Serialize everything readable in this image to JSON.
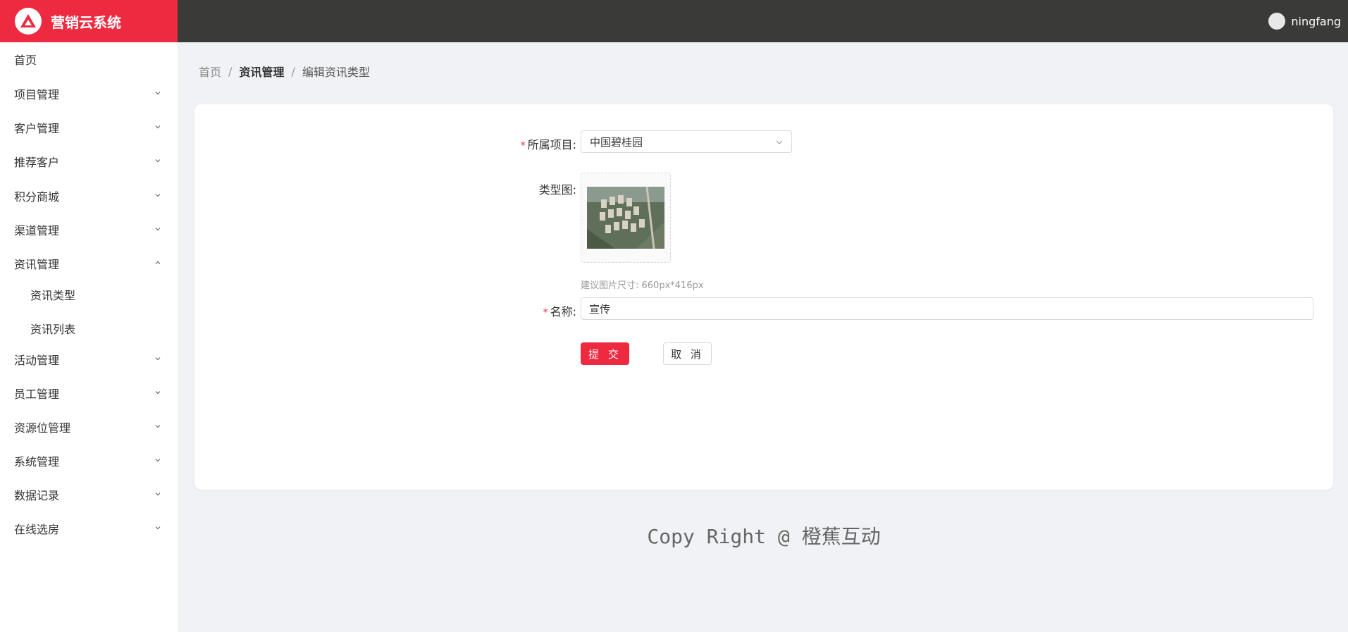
{
  "app": {
    "title": "营销云系统",
    "logo_icon": "triangle-logo-icon",
    "brand_color": "#ee2a41",
    "header_color": "#3a3a38"
  },
  "user": {
    "name": "ningfang",
    "avatar_icon": "user-avatar-icon"
  },
  "sidebar": {
    "items": [
      {
        "label": "首页",
        "expandable": false
      },
      {
        "label": "项目管理",
        "expandable": true
      },
      {
        "label": "客户管理",
        "expandable": true
      },
      {
        "label": "推荐客户",
        "expandable": true
      },
      {
        "label": "积分商城",
        "expandable": true
      },
      {
        "label": "渠道管理",
        "expandable": true
      },
      {
        "label": "资讯管理",
        "expandable": true,
        "expanded": true,
        "children": [
          "资讯类型",
          "资讯列表"
        ]
      },
      {
        "label": "活动管理",
        "expandable": true
      },
      {
        "label": "员工管理",
        "expandable": true
      },
      {
        "label": "资源位管理",
        "expandable": true
      },
      {
        "label": "系统管理",
        "expandable": true
      },
      {
        "label": "数据记录",
        "expandable": true
      },
      {
        "label": "在线选房",
        "expandable": true
      }
    ]
  },
  "breadcrumb": {
    "home": "首页",
    "section": "资讯管理",
    "current": "编辑资讯类型",
    "separator": "/"
  },
  "form": {
    "project": {
      "required_mark": "*",
      "label": "所属项目:",
      "value": "中国碧桂园"
    },
    "image": {
      "label": "类型图:",
      "hint": "建议图片尺寸: 660px*416px"
    },
    "name": {
      "required_mark": "*",
      "label": "名称:",
      "value": "宣传"
    },
    "submit_label": "提 交",
    "cancel_label": "取 消"
  },
  "footer": {
    "text": "Copy Right @ 橙蕉互动"
  }
}
